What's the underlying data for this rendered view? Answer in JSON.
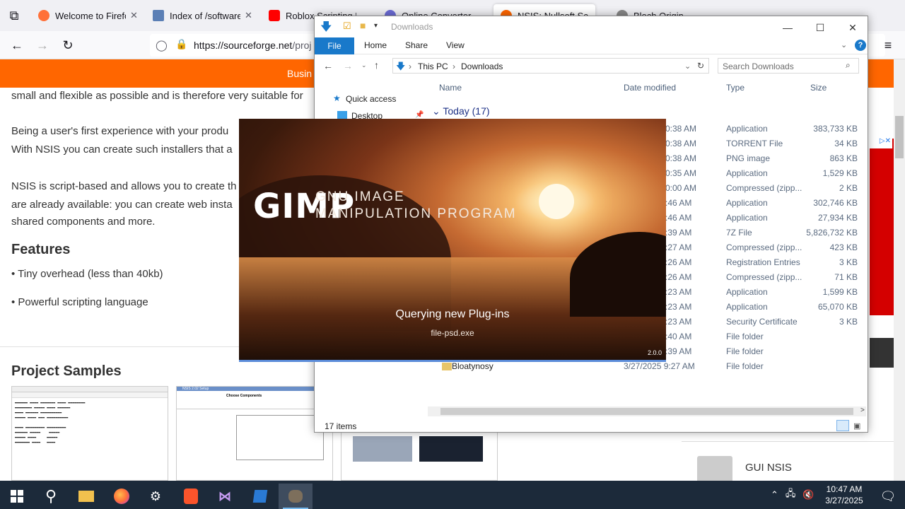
{
  "browser": {
    "tabs": [
      {
        "label": "Welcome to Firefox",
        "icon": "firefox-icon",
        "color": "#ff7139"
      },
      {
        "label": "Index of /software/",
        "icon": "document-icon",
        "color": "#5b7fb5"
      },
      {
        "label": "Roblox Scripting R",
        "icon": "youtube-icon",
        "color": "#ff0000"
      },
      {
        "label": "Online Converter",
        "icon": "converter-icon",
        "color": "#6b6bd6"
      },
      {
        "label": "NSIS: Nullsoft Scri",
        "icon": "sourceforge-icon",
        "color": "#ff6600"
      },
      {
        "label": "Bloch Origin",
        "icon": "page-icon",
        "color": "#888888"
      }
    ],
    "url_main": "https://sourceforge.net",
    "url_rest": "/proj"
  },
  "page": {
    "nav_link": "Busin",
    "line1": "small and flexible as possible and is therefore very suitable for",
    "line2": "Being a user's first experience with your produ",
    "line3": "With NSIS you can create such installers that a",
    "line4": "NSIS is script-based and allows you to create th",
    "line5": "are already available: you can create web insta",
    "line6": "shared components and more.",
    "features_heading": "Features",
    "feature1": "Tiny overhead (less than 40kb)",
    "feature2": "Powerful scripting language",
    "samples_heading": "Project Samples",
    "gui_nsis": "GUI NSIS",
    "sample2_title": "NSIS 2.02 Setup",
    "sample2_heading": "Choose Components"
  },
  "explorer": {
    "title": "Downloads",
    "ribbon_tabs": {
      "file": "File",
      "home": "Home",
      "share": "Share",
      "view": "View"
    },
    "breadcrumb": {
      "root": "This PC",
      "folder": "Downloads"
    },
    "search_placeholder": "Search Downloads",
    "nav": {
      "quick_access": "Quick access",
      "desktop": "Desktop"
    },
    "columns": {
      "name": "Name",
      "date": "Date modified",
      "type": "Type",
      "size": "Size"
    },
    "group": "Today (17)",
    "rows": [
      {
        "time": "0:38 AM",
        "type": "Application",
        "size": "383,733 KB"
      },
      {
        "time": "0:38 AM",
        "type": "TORRENT File",
        "size": "34 KB"
      },
      {
        "time": "0:38 AM",
        "type": "PNG image",
        "size": "863 KB"
      },
      {
        "time": "0:35 AM",
        "type": "Application",
        "size": "1,529 KB"
      },
      {
        "time": "0:00 AM",
        "type": "Compressed (zipp...",
        "size": "2 KB"
      },
      {
        "time": ":46 AM",
        "type": "Application",
        "size": "302,746 KB"
      },
      {
        "time": ":46 AM",
        "type": "Application",
        "size": "27,934 KB"
      },
      {
        "time": ":39 AM",
        "type": "7Z File",
        "size": "5,826,732 KB"
      },
      {
        "time": ":27 AM",
        "type": "Compressed (zipp...",
        "size": "423 KB"
      },
      {
        "time": ":26 AM",
        "type": "Registration Entries",
        "size": "3 KB"
      },
      {
        "time": ":26 AM",
        "type": "Compressed (zipp...",
        "size": "71 KB"
      },
      {
        "time": ":23 AM",
        "type": "Application",
        "size": "1,599 KB"
      },
      {
        "time": ":23 AM",
        "type": "Application",
        "size": "65,070 KB"
      },
      {
        "time": ":23 AM",
        "type": "Security Certificate",
        "size": "3 KB"
      },
      {
        "time": ":40 AM",
        "type": "File folder",
        "size": ""
      },
      {
        "time": ":39 AM",
        "type": "File folder",
        "size": ""
      },
      {
        "name": "Bloatynosy",
        "time": "3/27/2025 9:27 AM",
        "type": "File folder",
        "size": ""
      }
    ],
    "status": "17 items"
  },
  "gimp": {
    "logo": "GIMP",
    "subtitle1": "GNU IMAGE",
    "subtitle2": "MANIPULATION PROGRAM",
    "status": "Querying new Plug-ins",
    "file": "file-psd.exe",
    "version": "2.0.0"
  },
  "taskbar": {
    "time": "10:47 AM",
    "date": "3/27/2025"
  }
}
